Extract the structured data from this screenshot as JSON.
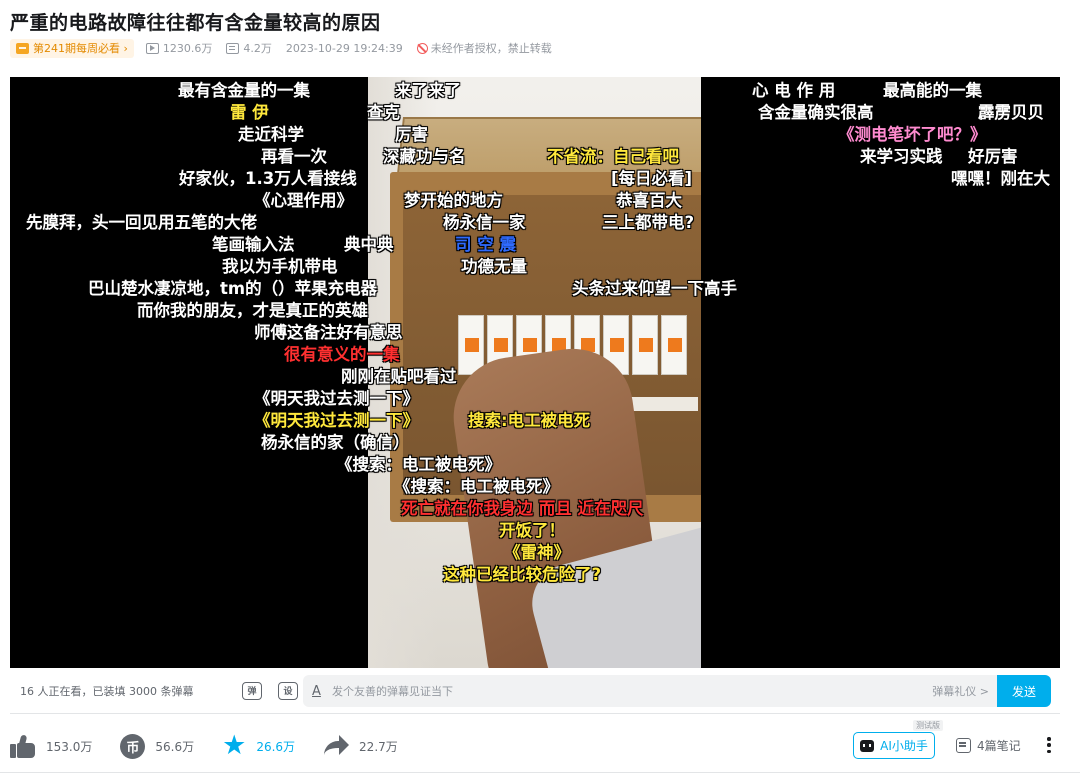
{
  "video": {
    "title": "严重的电路故障往往都有含金量较高的原因",
    "weekly_badge": "第241期每周必看",
    "views": "1230.6万",
    "danmaku_count": "4.2万",
    "publish_time": "2023-10-29 19:24:39",
    "copyright": "未经作者授权，禁止转载"
  },
  "danmaku": [
    {
      "text": "最有含金量的一集",
      "color": "white"
    },
    {
      "text": "来了来了",
      "color": "white"
    },
    {
      "text": "心 电 作 用",
      "color": "white"
    },
    {
      "text": "最高能的一集",
      "color": "white"
    },
    {
      "text": "雷    伊",
      "color": "yellow"
    },
    {
      "text": "查克",
      "color": "white"
    },
    {
      "text": "含金量确实很高",
      "color": "white"
    },
    {
      "text": "霹雳贝贝",
      "color": "white"
    },
    {
      "text": "走近科学",
      "color": "white"
    },
    {
      "text": "厉害",
      "color": "white"
    },
    {
      "text": "《测电笔坏了吧？》",
      "color": "pink"
    },
    {
      "text": "再看一次",
      "color": "white"
    },
    {
      "text": "深藏功与名",
      "color": "white"
    },
    {
      "text": "不省流：自己看吧",
      "color": "yellow"
    },
    {
      "text": "来学习实践",
      "color": "white"
    },
    {
      "text": "好厉害",
      "color": "white"
    },
    {
      "text": "好家伙，1.3万人看接线",
      "color": "white"
    },
    {
      "text": "[每日必看]",
      "color": "white"
    },
    {
      "text": "嘿嘿！刚在大",
      "color": "white"
    },
    {
      "text": "《心理作用》",
      "color": "white"
    },
    {
      "text": "梦开始的地方",
      "color": "white"
    },
    {
      "text": "恭喜百大",
      "color": "white"
    },
    {
      "text": "先膜拜，头一回见用五笔的大佬",
      "color": "white"
    },
    {
      "text": "杨永信一家",
      "color": "white"
    },
    {
      "text": "三上都带电?",
      "color": "white"
    },
    {
      "text": "笔画输入法",
      "color": "white"
    },
    {
      "text": "典中典",
      "color": "white"
    },
    {
      "text": "司 空 震",
      "color": "blue"
    },
    {
      "text": "我以为手机带电",
      "color": "white"
    },
    {
      "text": "功德无量",
      "color": "white"
    },
    {
      "text": "巴山楚水凄凉地，tm的（）苹果充电器",
      "color": "white"
    },
    {
      "text": "头条过来仰望一下高手",
      "color": "white"
    },
    {
      "text": "而你我的朋友，才是真正的英雄",
      "color": "white"
    },
    {
      "text": "师傅这备注好有意思",
      "color": "white"
    },
    {
      "text": "很有意义的一集",
      "color": "red"
    },
    {
      "text": "刚刚在贴吧看过",
      "color": "white"
    },
    {
      "text": "《明天我过去测一下》",
      "color": "white"
    },
    {
      "text": "《明天我过去测一下》",
      "color": "yellow"
    },
    {
      "text": "搜索:电工被电死",
      "color": "yellow"
    },
    {
      "text": "杨永信的家（确信）",
      "color": "white"
    },
    {
      "text": "《搜索：电工被电死》",
      "color": "white"
    },
    {
      "text": "《搜索：电工被电死》",
      "color": "white"
    },
    {
      "text": "死亡就在你我身边 而且 近在咫尺",
      "color": "red"
    },
    {
      "text": "开饭了！",
      "color": "yellow"
    },
    {
      "text": "《雷神》",
      "color": "yellow"
    },
    {
      "text": "这种已经比较危险了?",
      "color": "yellow"
    }
  ],
  "danmaku_bar": {
    "status": "16 人正在看，已装填 3000 条弹幕",
    "toggle_label": "弹",
    "settings_label": "设",
    "font_icon": "A",
    "placeholder": "发个友善的弹幕见证当下",
    "etiquette": "弹幕礼仪 >",
    "send": "发送"
  },
  "actions": {
    "like": "153.0万",
    "coin": "56.6万",
    "coin_symbol": "币",
    "favorite": "26.6万",
    "share": "22.7万",
    "ai_tag": "测试版",
    "ai_assistant": "AI小助手",
    "notes": "4篇笔记"
  },
  "colors": {
    "accent": "#00aeec",
    "danmaku_yellow": "#ffe83c",
    "danmaku_red": "#ff3030",
    "danmaku_blue": "#2f6bff",
    "danmaku_pink": "#ff8bd0"
  }
}
